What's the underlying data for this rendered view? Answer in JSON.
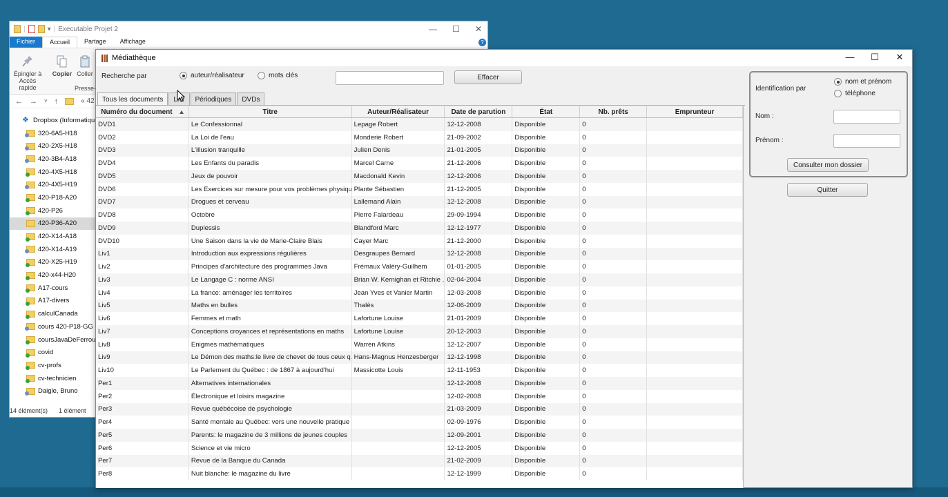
{
  "explorer": {
    "title": "Executable Projet 2",
    "window_controls": {
      "minimize": "—",
      "maximize": "☐",
      "close": "✕"
    },
    "ribbon_tabs": [
      "Fichier",
      "Accueil",
      "Partage",
      "Affichage"
    ],
    "ribbon": {
      "pin_label_1": "Épingler à",
      "pin_label_2": "Accès rapide",
      "copy_label": "Copier",
      "paste_label": "Coller",
      "clipboard_group": "Presse-"
    },
    "path_fragment": "« 42",
    "tree": [
      {
        "label": "Dropbox (Informatiqu",
        "icon": "dropbox-icon",
        "root": true
      },
      {
        "label": "320-6A5-H18",
        "icon": "shared-folder-icon"
      },
      {
        "label": "420-2X5-H18",
        "icon": "shared-folder-icon"
      },
      {
        "label": "420-3B4-A18",
        "icon": "shared-folder-icon"
      },
      {
        "label": "420-4X5-H18",
        "icon": "synced-folder-icon"
      },
      {
        "label": "420-4X5-H19",
        "icon": "shared-folder-icon"
      },
      {
        "label": "420-P18-A20",
        "icon": "synced-folder-icon"
      },
      {
        "label": "420-P26",
        "icon": "synced-folder-icon"
      },
      {
        "label": "420-P36-A20",
        "icon": "folder-icon",
        "selected": true
      },
      {
        "label": "420-X14-A18",
        "icon": "synced-folder-icon"
      },
      {
        "label": "420-X14-A19",
        "icon": "shared-folder-icon"
      },
      {
        "label": "420-X25-H19",
        "icon": "synced-folder-icon"
      },
      {
        "label": "420-x44-H20",
        "icon": "synced-folder-icon"
      },
      {
        "label": "A17-cours",
        "icon": "synced-folder-icon"
      },
      {
        "label": "A17-divers",
        "icon": "synced-folder-icon"
      },
      {
        "label": "calculCanada",
        "icon": "synced-folder-icon"
      },
      {
        "label": "cours 420-P18-GG",
        "icon": "shared-folder-icon"
      },
      {
        "label": "coursJavaDeFerroud",
        "icon": "synced-folder-icon"
      },
      {
        "label": "covid",
        "icon": "synced-folder-icon"
      },
      {
        "label": "cv-profs",
        "icon": "synced-folder-icon"
      },
      {
        "label": "cv-technicien",
        "icon": "synced-folder-icon"
      },
      {
        "label": "Daigle, Bruno",
        "icon": "shared-folder-icon"
      }
    ],
    "status_items": "14 élément(s)",
    "status_selected": "1 élément"
  },
  "media": {
    "title": "Médiathèque",
    "window_controls": {
      "minimize": "—",
      "maximize": "☐",
      "close": "✕"
    },
    "search_label": "Recherche par",
    "radio_author": "auteur/réalisateur",
    "radio_keywords": "mots clés",
    "search_value": "",
    "clear_button": "Effacer",
    "tabs": [
      "Tous les documents",
      "Livres",
      "Périodiques",
      "DVDs"
    ],
    "tab_livres_visible": "Livr",
    "columns": [
      "Numéro du document",
      "Titre",
      "Auteur/Réalisateur",
      "Date de parution",
      "État",
      "Nb. prêts",
      "Emprunteur"
    ],
    "rows": [
      [
        "DVD1",
        "Le Confessionnal",
        "Lepage Robert",
        "12-12-2008",
        "Disponible",
        "0",
        ""
      ],
      [
        "DVD2",
        "La Loi de l'eau",
        "Monderie Robert",
        "21-09-2002",
        "Disponible",
        "0",
        ""
      ],
      [
        "DVD3",
        "L'illusion tranquille",
        "Julien Denis",
        "21-01-2005",
        "Disponible",
        "0",
        ""
      ],
      [
        "DVD4",
        "Les Enfants du paradis",
        "Marcel Carne",
        "21-12-2006",
        "Disponible",
        "0",
        ""
      ],
      [
        "DVD5",
        "Jeux de pouvoir",
        "Macdonald Kevin",
        "12-12-2006",
        "Disponible",
        "0",
        ""
      ],
      [
        "DVD6",
        "Les Exercices sur mesure pour vos problèmes physiqu...",
        "Plante Sébastien",
        "21-12-2005",
        "Disponible",
        "0",
        ""
      ],
      [
        "DVD7",
        "Drogues et cerveau",
        "Lallemand Alain",
        "12-12-2008",
        "Disponible",
        "0",
        ""
      ],
      [
        "DVD8",
        "Octobre",
        "Pierre Falardeau",
        "29-09-1994",
        "Disponible",
        "0",
        ""
      ],
      [
        "DVD9",
        "Duplessis",
        "Blandford Marc",
        "12-12-1977",
        "Disponible",
        "0",
        ""
      ],
      [
        "DVD10",
        "Une Saison dans la vie de Marie-Claire Blais",
        "Cayer Marc",
        "21-12-2000",
        "Disponible",
        "0",
        ""
      ],
      [
        "Liv1",
        "Introduction aux expressions régulières",
        "Desgraupes Bernard",
        "12-12-2008",
        "Disponible",
        "0",
        ""
      ],
      [
        "Liv2",
        "Principes d'architecture des programmes Java",
        "Frémaux Valéry-Guilhem",
        "01-01-2005",
        "Disponible",
        "0",
        ""
      ],
      [
        "Liv3",
        "Le Langage C : norme ANSI",
        "Brian W. Kernighan et Ritchie ...",
        "02-04-2004",
        "Disponible",
        "0",
        ""
      ],
      [
        "Liv4",
        "La france: aménager les territoires",
        "Jean Yves  et  Vanier Martin",
        "12-03-2008",
        "Disponible",
        "0",
        ""
      ],
      [
        "Liv5",
        "Maths en bulles",
        "Thalès",
        "12-06-2009",
        "Disponible",
        "0",
        ""
      ],
      [
        "Liv6",
        "Femmes et math",
        "Lafortune Louise",
        "21-01-2009",
        "Disponible",
        "0",
        ""
      ],
      [
        "Liv7",
        "Conceptions croyances et représentations en maths",
        "Lafortune Louise",
        "20-12-2003",
        "Disponible",
        "0",
        ""
      ],
      [
        "Liv8",
        "Enigmes mathématiques",
        "Warren Atkins",
        "12-12-2007",
        "Disponible",
        "0",
        ""
      ],
      [
        "Liv9",
        "Le Démon des maths:le livre de chevet de tous ceux q...",
        "Hans-Magnus Henzesberger",
        "12-12-1998",
        "Disponible",
        "0",
        ""
      ],
      [
        "Liv10",
        "Le Parlement du Québec : de 1867 à aujourd'hui",
        "Massicotte Louis",
        "12-11-1953",
        "Disponible",
        "0",
        ""
      ],
      [
        "Per1",
        "Alternatives internationales",
        "",
        "12-12-2008",
        "Disponible",
        "0",
        ""
      ],
      [
        "Per2",
        "Électronique et loisirs magazine",
        "",
        "12-02-2008",
        "Disponible",
        "0",
        ""
      ],
      [
        "Per3",
        "Revue québécoise de psychologie",
        "",
        "21-03-2009",
        "Disponible",
        "0",
        ""
      ],
      [
        "Per4",
        "Santé mentale au Québec: vers une nouvelle pratique",
        "",
        "02-09-1976",
        "Disponible",
        "0",
        ""
      ],
      [
        "Per5",
        "Parents: le magazine de 3 millions de jeunes couples",
        "",
        "12-09-2001",
        "Disponible",
        "0",
        ""
      ],
      [
        "Per6",
        "Science et vie micro",
        "",
        "12-12-2005",
        "Disponible",
        "0",
        ""
      ],
      [
        "Per7",
        "Revue de la Banque du Canada",
        "",
        "21-02-2009",
        "Disponible",
        "0",
        ""
      ],
      [
        "Per8",
        "Nuit blanche: le magazine du livre",
        "",
        "12-12-1999",
        "Disponible",
        "0",
        ""
      ]
    ],
    "ident": {
      "label": "Identification par",
      "radio_name": "nom et prénom",
      "radio_phone": "téléphone",
      "nom_label": "Nom :",
      "prenom_label": "Prénom :",
      "nom_value": "",
      "prenom_value": "",
      "consult_button": "Consulter mon dossier"
    },
    "quit_button": "Quitter"
  },
  "colors": {
    "desktop": "#1f6a91",
    "ribbon_file_tab": "#1979ca",
    "window_bg": "#f0f0f0"
  }
}
